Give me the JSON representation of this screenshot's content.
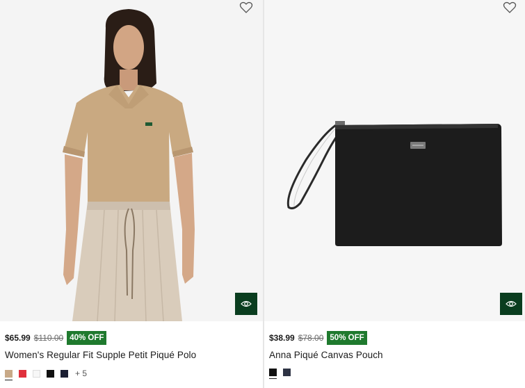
{
  "products": [
    {
      "price": "$65.99",
      "original_price": "$110.00",
      "discount": "40% OFF",
      "name": "Women's Regular Fit Supple Petit Piqué Polo",
      "swatches": [
        "#c8a987",
        "#e0303c",
        "#f7f7f7",
        "#111111",
        "#1b1f33"
      ],
      "more_colors": "+ 5",
      "icons": {
        "favorite": "heart-outline-icon",
        "quick_view": "eye-icon"
      }
    },
    {
      "price": "$38.99",
      "original_price": "$78.00",
      "discount": "50% OFF",
      "name": "Anna Piqué Canvas Pouch",
      "swatches": [
        "#111111",
        "#2e3344"
      ],
      "icons": {
        "favorite": "heart-outline-icon",
        "quick_view": "eye-icon"
      }
    }
  ],
  "colors": {
    "badge": "#1f7a2e",
    "quick_view_bg": "#0a3d1f"
  }
}
